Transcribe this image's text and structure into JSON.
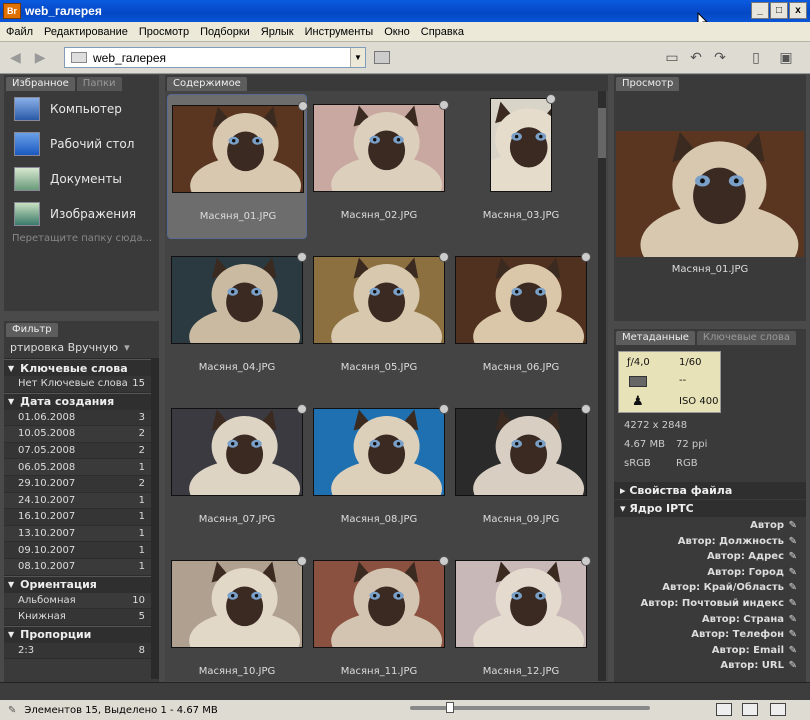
{
  "window": {
    "title": "web_галерея",
    "app_icon": "Br",
    "controls": [
      "_",
      "□",
      "x"
    ]
  },
  "menu": [
    "Файл",
    "Редактирование",
    "Просмотр",
    "Подборки",
    "Ярлык",
    "Инструменты",
    "Окно",
    "Справка"
  ],
  "toolbar": {
    "path": "web_галерея",
    "back_icon": "back-arrow-icon",
    "forward_icon": "forward-arrow-icon"
  },
  "favorites": {
    "tabs": [
      "Избранное",
      "Папки"
    ],
    "items": [
      {
        "label": "Компьютер",
        "icon": "computer-icon"
      },
      {
        "label": "Рабочий стол",
        "icon": "desktop-icon"
      },
      {
        "label": "Документы",
        "icon": "documents-icon"
      },
      {
        "label": "Изображения",
        "icon": "pictures-icon"
      }
    ],
    "hint": "Перетащите папку сюда..."
  },
  "filter": {
    "tab": "Фильтр",
    "sort": "ртировка Вручную",
    "groups": [
      {
        "title": "Ключевые слова",
        "rows": [
          {
            "label": "Нет Ключевые слова",
            "count": "15"
          }
        ]
      },
      {
        "title": "Дата создания",
        "rows": [
          {
            "label": "01.06.2008",
            "count": "3"
          },
          {
            "label": "10.05.2008",
            "count": "2"
          },
          {
            "label": "07.05.2008",
            "count": "2"
          },
          {
            "label": "06.05.2008",
            "count": "1"
          },
          {
            "label": "29.10.2007",
            "count": "2"
          },
          {
            "label": "24.10.2007",
            "count": "1"
          },
          {
            "label": "16.10.2007",
            "count": "1"
          },
          {
            "label": "13.10.2007",
            "count": "1"
          },
          {
            "label": "09.10.2007",
            "count": "1"
          },
          {
            "label": "08.10.2007",
            "count": "1"
          }
        ]
      },
      {
        "title": "Ориентация",
        "rows": [
          {
            "label": "Альбомная",
            "count": "10"
          },
          {
            "label": "Книжная",
            "count": "5"
          }
        ]
      },
      {
        "title": "Пропорции",
        "rows": [
          {
            "label": "2:3",
            "count": "8"
          }
        ]
      }
    ]
  },
  "content": {
    "tab": "Содержимое",
    "items": [
      {
        "name": "Масяня_01.JPG",
        "selected": true,
        "orient": "land",
        "bg": "#5a3520",
        "fur": "#d8c8b0"
      },
      {
        "name": "Масяня_02.JPG",
        "orient": "land",
        "bg": "#c8a8a0",
        "fur": "#dcd0bc"
      },
      {
        "name": "Масяня_03.JPG",
        "orient": "port",
        "bg": "#d8d4c8",
        "fur": "#e6dccc"
      },
      {
        "name": "Масяня_04.JPG",
        "orient": "land",
        "bg": "#2a3a40",
        "fur": "#cbbaa2"
      },
      {
        "name": "Масяня_05.JPG",
        "orient": "land",
        "bg": "#8c7040",
        "fur": "#d8c8ae"
      },
      {
        "name": "Масяня_06.JPG",
        "orient": "land",
        "bg": "#50301e",
        "fur": "#dac6a8"
      },
      {
        "name": "Масяня_07.JPG",
        "orient": "land",
        "bg": "#3a3a40",
        "fur": "#ddd4c4"
      },
      {
        "name": "Масяня_08.JPG",
        "orient": "land",
        "bg": "#1f70b0",
        "fur": "#ddd0ba"
      },
      {
        "name": "Масяня_09.JPG",
        "orient": "land",
        "bg": "#2a2a2a",
        "fur": "#d8cfc2"
      },
      {
        "name": "Масяня_10.JPG",
        "orient": "land",
        "bg": "#b0a090",
        "fur": "#e2d8c8"
      },
      {
        "name": "Масяня_11.JPG",
        "orient": "land",
        "bg": "#8a5040",
        "fur": "#d2c4b0"
      },
      {
        "name": "Масяня_12.JPG",
        "orient": "land",
        "bg": "#c8b8b8",
        "fur": "#e4dace"
      }
    ]
  },
  "preview": {
    "tab": "Просмотр",
    "name": "Масяня_01.JPG"
  },
  "metadata": {
    "tabs": [
      "Метаданные",
      "Ключевые слова"
    ],
    "aperture": "ƒ/4,0",
    "shutter": "1/60",
    "metering": "--",
    "iso": "ISO 400",
    "dimensions": "4272 x 2848",
    "size": "4.67 MB",
    "ppi": "72 ppi",
    "colorspace": "sRGB",
    "mode": "RGB",
    "groups": [
      "Свойства файла",
      "Ядро IPTC"
    ],
    "fields": [
      "Автор",
      "Автор: Должность",
      "Автор: Адрес",
      "Автор: Город",
      "Автор: Край/Область",
      "Автор: Почтовый индекс",
      "Автор: Страна",
      "Автор: Телефон",
      "Автор: Email",
      "Автор: URL"
    ]
  },
  "status": {
    "text": "Элементов 15, Выделено 1 - 4.67 MB"
  }
}
